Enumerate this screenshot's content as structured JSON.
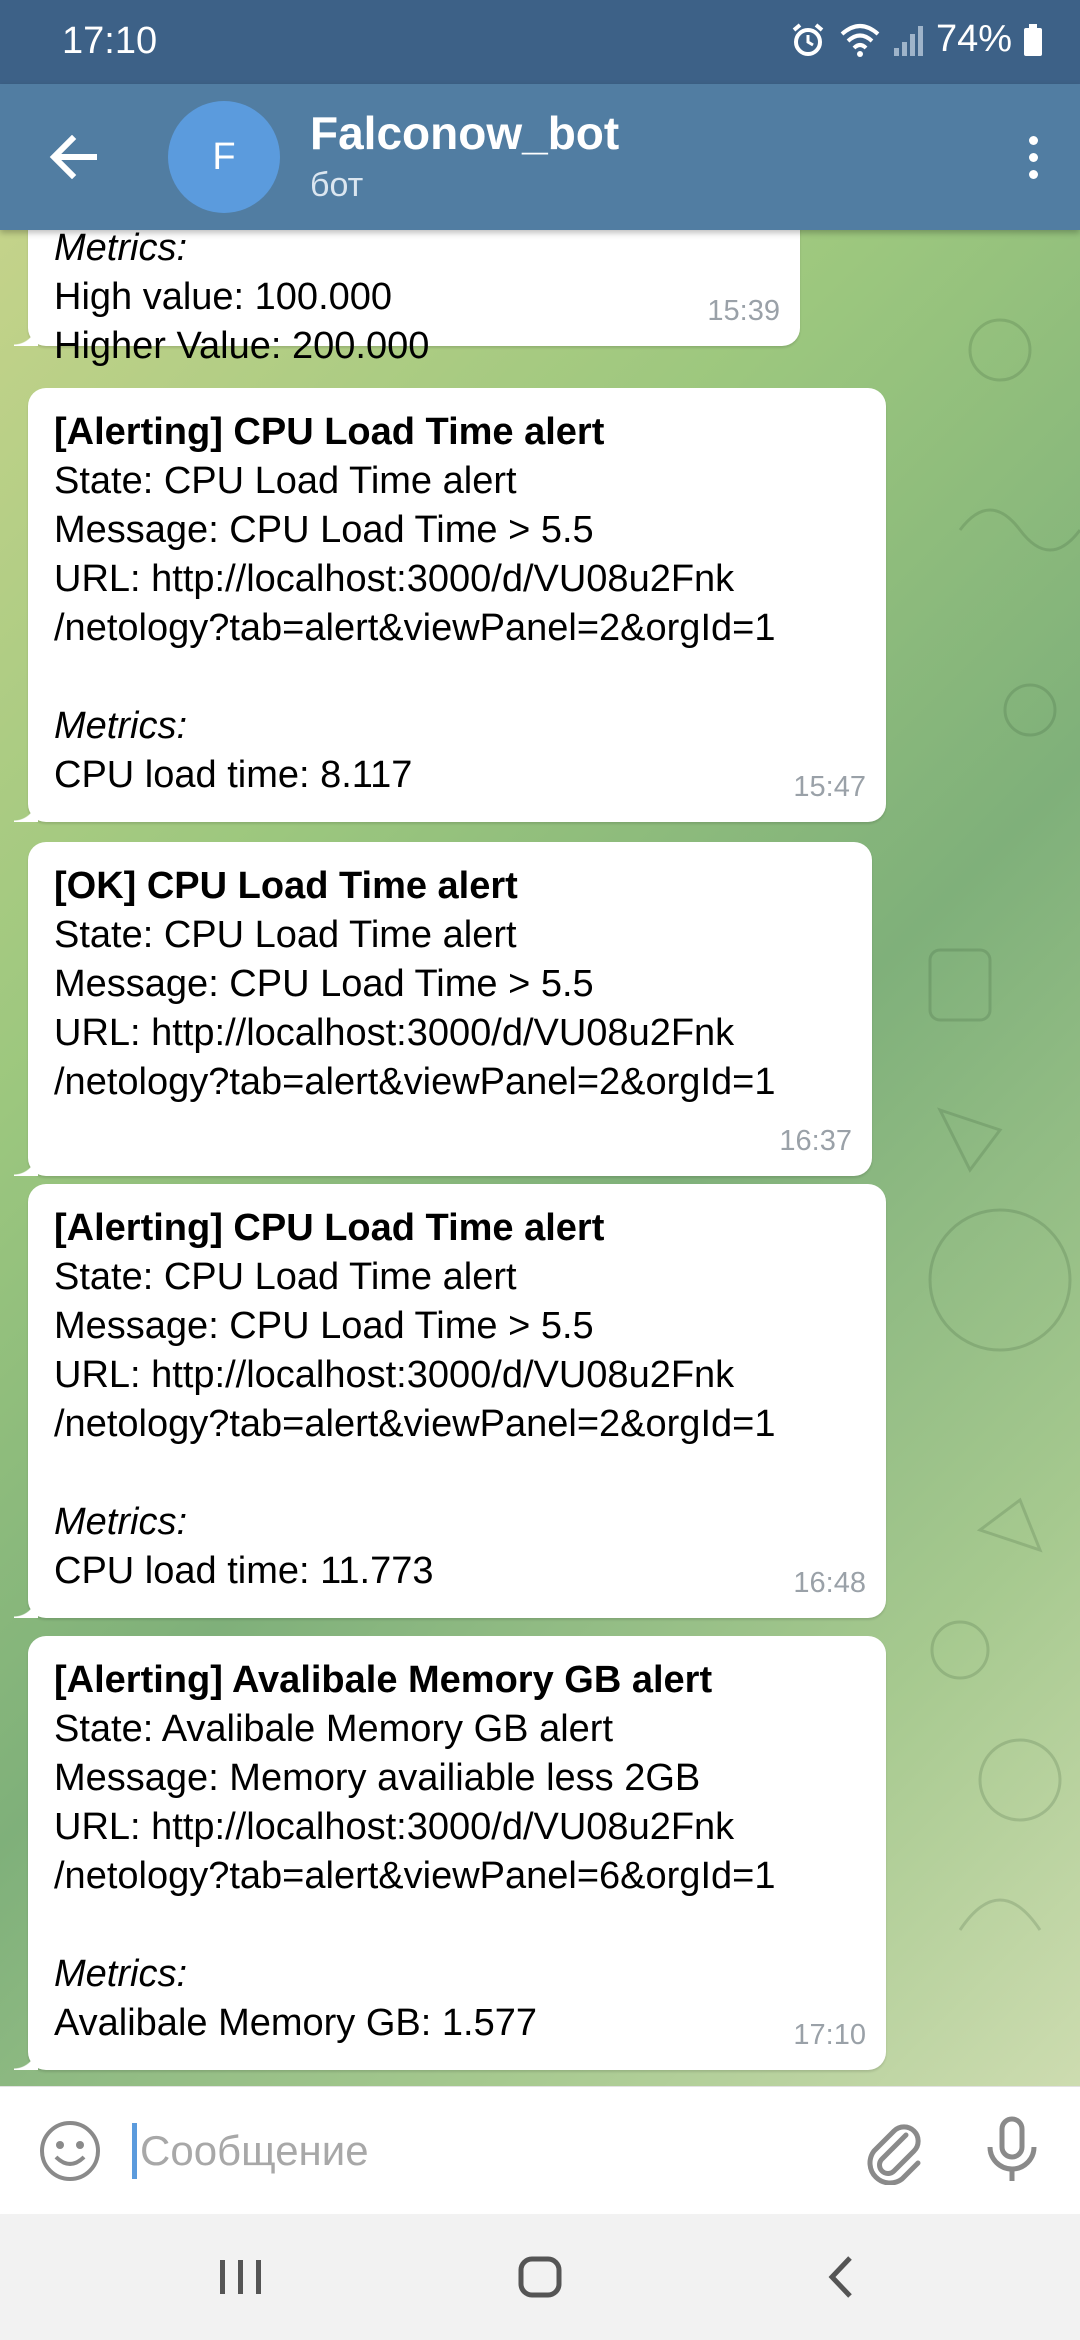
{
  "status_bar": {
    "time": "17:10",
    "battery": "74%"
  },
  "header": {
    "avatar_letter": "F",
    "title": "Falconow_bot",
    "subtitle": "бот"
  },
  "messages": [
    {
      "lines": [
        "Metrics:",
        "High value: 100.000",
        "Higher Value: 200.000"
      ],
      "time": "15:39"
    },
    {
      "lines": [
        "[Alerting] CPU Load Time alert",
        "State: CPU Load Time alert",
        "Message: CPU Load Time > 5.5",
        "URL: http://localhost:3000/d/VU08u2Fnk",
        "/netology?tab=alert&viewPanel=2&orgId=1",
        "",
        "Metrics:",
        "CPU load time: 8.117"
      ],
      "time": "15:47"
    },
    {
      "lines": [
        "[OK] CPU Load Time alert",
        "State: CPU Load Time alert",
        "Message: CPU Load Time > 5.5",
        "URL: http://localhost:3000/d/VU08u2Fnk",
        "/netology?tab=alert&viewPanel=2&orgId=1"
      ],
      "time": "16:37"
    },
    {
      "lines": [
        "[Alerting] CPU Load Time alert",
        "State: CPU Load Time alert",
        "Message: CPU Load Time > 5.5",
        "URL: http://localhost:3000/d/VU08u2Fnk",
        "/netology?tab=alert&viewPanel=2&orgId=1",
        "",
        "Metrics:",
        "CPU load time: 11.773"
      ],
      "time": "16:48"
    },
    {
      "lines": [
        "[Alerting] Avalibale Memory GB alert",
        "State: Avalibale Memory GB alert",
        "Message: Memory availiable less 2GB",
        "URL: http://localhost:3000/d/VU08u2Fnk",
        "/netology?tab=alert&viewPanel=6&orgId=1",
        "",
        "Metrics:",
        "Avalibale Memory GB: 1.577"
      ],
      "time": "17:10"
    }
  ],
  "composer": {
    "placeholder": "Сообщение",
    "value": ""
  },
  "icons": {
    "alarm": "alarm-icon",
    "wifi": "wifi-icon",
    "signal": "signal-icon",
    "battery": "battery-icon",
    "back": "arrow-left-icon",
    "menu": "more-vertical-icon",
    "emoji": "smile-icon",
    "attach": "paperclip-icon",
    "mic": "microphone-icon",
    "nav_recent": "recent-apps-icon",
    "nav_home": "home-icon",
    "nav_back": "chevron-left-icon"
  },
  "colors": {
    "status_bar": "#3d6187",
    "app_bar": "#517da2",
    "avatar": "#5b9bdd",
    "bubble": "#ffffff",
    "time_text": "#9aa1a8",
    "caret": "#5b9bdd"
  }
}
